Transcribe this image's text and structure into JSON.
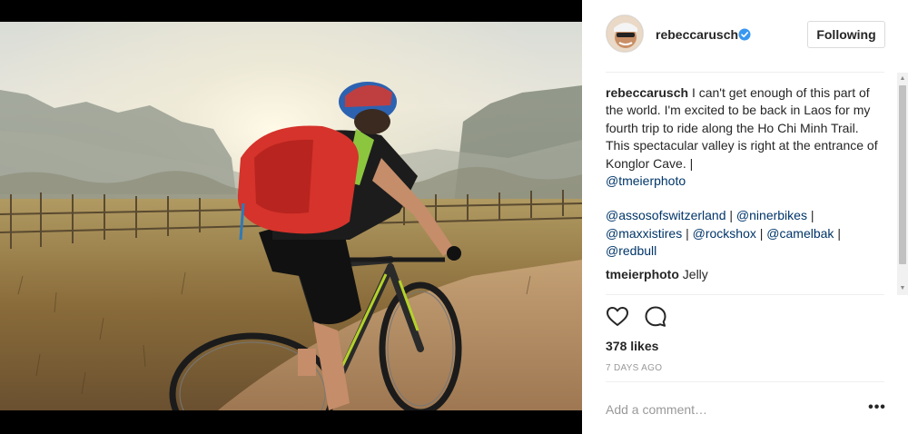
{
  "post": {
    "image_alt": "Cyclist riding a mountain bike on a dirt path through a misty valley",
    "author": {
      "username": "rebeccarusch",
      "verified": true,
      "follow_label": "Following"
    },
    "comments": [
      {
        "user": "rebeccarusch",
        "text": "I can't get enough of this part of the world. I'm excited to be back in Laos for my fourth trip to ride along the Ho Chi Minh Trail. This spectacular valley is right at the entrance of Konglor Cave. |",
        "tags_line1": "@tmeierphoto",
        "tags": [
          "@assosofswitzerland",
          "@ninerbikes",
          "@maxxistires",
          "@rockshox",
          "@camelbak",
          "@redbull"
        ]
      },
      {
        "user": "tmeierphoto",
        "text": "Jelly"
      }
    ],
    "likes_label": "378 likes",
    "timestamp": "7 DAYS AGO",
    "comment_placeholder": "Add a comment…",
    "more_label": "•••"
  },
  "icons": {
    "verified": "verified-badge-icon",
    "like": "heart-icon",
    "comment": "speech-bubble-icon",
    "more": "more-options-icon"
  },
  "colors": {
    "verified": "#3897f0",
    "tag_link": "#003569",
    "muted": "#999999",
    "text": "#262626"
  }
}
